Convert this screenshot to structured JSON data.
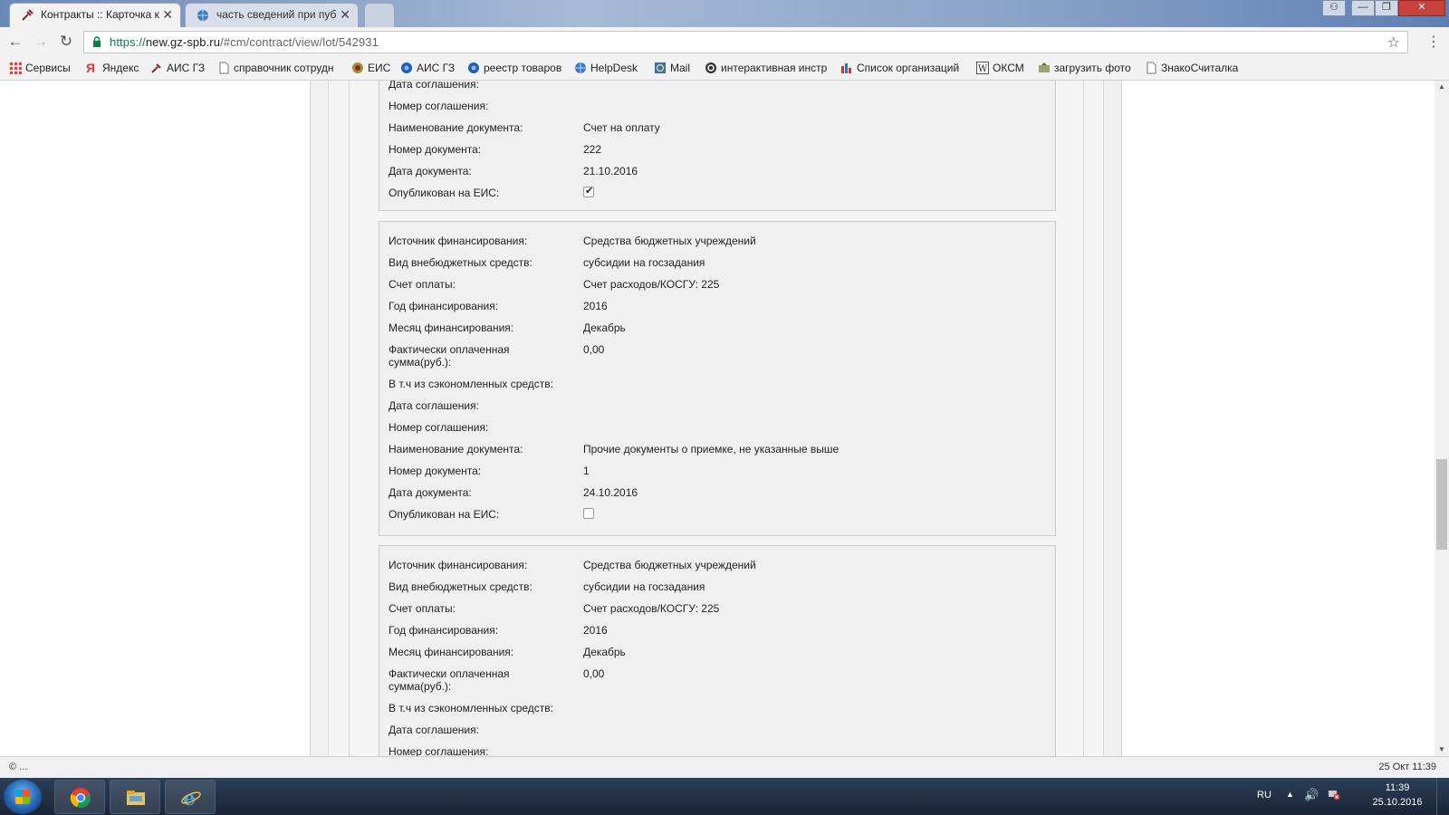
{
  "browser": {
    "tabs": [
      {
        "title": "Контракты :: Карточка к",
        "active": true,
        "icon": "tools-icon"
      },
      {
        "title": "часть сведений при пуб",
        "active": false,
        "icon": "globe-icon"
      }
    ],
    "new_tab_icon": "new-tab-icon",
    "url_scheme": "https://",
    "url_host": "new.gz-spb.ru",
    "url_rest": "/#cm/contract/view/lot/542931",
    "bookmarks": [
      {
        "label": "Сервисы",
        "icon": "apps-grid-icon"
      },
      {
        "label": "Яндекс",
        "icon": "yandex-icon"
      },
      {
        "label": "АИС ГЗ",
        "icon": "tools-icon"
      },
      {
        "label": "справочник сотрудн",
        "icon": "page-icon"
      },
      {
        "label": "ЕИС",
        "icon": "emblem-icon"
      },
      {
        "label": "АИС ГЗ",
        "icon": "blue-gear-icon"
      },
      {
        "label": "реестр товаров",
        "icon": "blue-gear-icon"
      },
      {
        "label": "HelpDesk",
        "icon": "globe-icon"
      },
      {
        "label": "Mail",
        "icon": "mail-icon"
      },
      {
        "label": "интерактивная инстр",
        "icon": "circle-c-icon"
      },
      {
        "label": "Список организаций",
        "icon": "org-icon"
      },
      {
        "label": "ОКСМ",
        "icon": "wiki-icon"
      },
      {
        "label": "загрузить фото",
        "icon": "upload-photo-icon"
      },
      {
        "label": "ЗнакоСчиталка",
        "icon": "page-icon"
      }
    ]
  },
  "cards": [
    {
      "rows": [
        {
          "label": "Дата соглашения:",
          "value": ""
        },
        {
          "label": "Номер соглашения:",
          "value": ""
        },
        {
          "label": "Наименование документа:",
          "value": "Счет на оплату"
        },
        {
          "label": "Номер документа:",
          "value": "222"
        },
        {
          "label": "Дата документа:",
          "value": "21.10.2016"
        }
      ],
      "published_label": "Опубликован на ЕИС:",
      "published": true
    },
    {
      "rows": [
        {
          "label": "Источник финансирования:",
          "value": "Средства бюджетных учреждений"
        },
        {
          "label": "Вид внебюджетных средств:",
          "value": "субсидии на госзадания"
        },
        {
          "label": "Счет оплаты:",
          "value": "Счет расходов/КОСГУ: 225"
        },
        {
          "label": "Год финансирования:",
          "value": "2016"
        },
        {
          "label": "Месяц финансирования:",
          "value": "Декабрь"
        },
        {
          "label": "Фактически оплаченная сумма(руб.):",
          "value": "0,00"
        },
        {
          "label": "В т.ч из сэкономленных средств:",
          "value": ""
        },
        {
          "label": "Дата соглашения:",
          "value": ""
        },
        {
          "label": "Номер соглашения:",
          "value": ""
        },
        {
          "label": "Наименование документа:",
          "value": "Прочие документы о приемке, не указанные выше"
        },
        {
          "label": "Номер документа:",
          "value": "1"
        },
        {
          "label": "Дата документа:",
          "value": "24.10.2016"
        }
      ],
      "published_label": "Опубликован на ЕИС:",
      "published": false
    },
    {
      "rows": [
        {
          "label": "Источник финансирования:",
          "value": "Средства бюджетных учреждений"
        },
        {
          "label": "Вид внебюджетных средств:",
          "value": "субсидии на госзадания"
        },
        {
          "label": "Счет оплаты:",
          "value": "Счет расходов/КОСГУ: 225"
        },
        {
          "label": "Год финансирования:",
          "value": "2016"
        },
        {
          "label": "Месяц финансирования:",
          "value": "Декабрь"
        },
        {
          "label": "Фактически оплаченная сумма(руб.):",
          "value": "0,00"
        },
        {
          "label": "В т.ч из сэкономленных средств:",
          "value": ""
        },
        {
          "label": "Дата соглашения:",
          "value": ""
        },
        {
          "label": "Номер соглашения:",
          "value": ""
        }
      ]
    }
  ],
  "statusbar": {
    "left": "© ...",
    "right": "25 Окт 11:39"
  },
  "taskbar": {
    "apps": [
      "chrome-icon",
      "file-explorer-icon",
      "internet-explorer-icon"
    ],
    "lang": "RU",
    "time": "11:39",
    "date": "25.10.2016"
  }
}
